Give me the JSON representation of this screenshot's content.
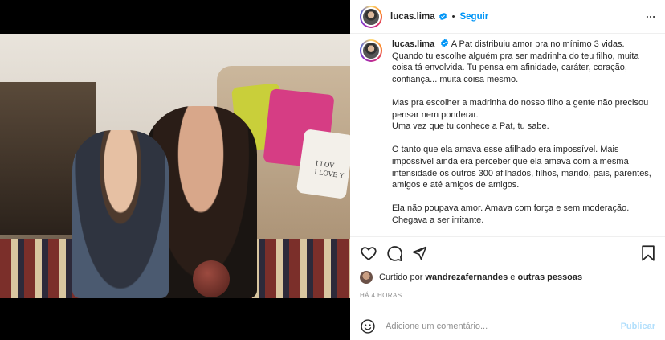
{
  "post": {
    "username": "lucas.lima",
    "follow_label": "Seguir",
    "separator": "•",
    "more_icon": "more-horizontal-icon",
    "verified_icon": "verified-badge-icon"
  },
  "caption": {
    "username": "lucas.lima",
    "paragraphs": [
      "A Pat distribuiu amor pra no mínimo 3 vidas. Quando tu escolhe alguém pra ser madrinha do teu filho, muita coisa tá envolvida. Tu pensa em afinidade, caráter, coração, confiança... muita coisa mesmo.",
      "Mas pra escolher a madrinha do nosso filho a gente não precisou pensar nem ponderar.\nUma vez que tu conhece a Pat, tu sabe.",
      "O tanto que ela amava esse afilhado era impossível. Mais impossível ainda era perceber que ela amava com a mesma intensidade os outros 300 afilhados, filhos, marido, pais, parentes, amigos e até amigos de amigos.",
      "Ela não poupava amor. Amava com força e sem moderação. Chegava a ser irritante."
    ]
  },
  "photo": {
    "pillow_text": "I LOV\nI LOVE Y"
  },
  "actions": {
    "like_icon": "heart-icon",
    "comment_icon": "comment-icon",
    "share_icon": "send-icon",
    "save_icon": "bookmark-icon"
  },
  "likes": {
    "prefix": "Curtido por",
    "user": "wandrezafernandes",
    "connector": "e",
    "others": "outras pessoas"
  },
  "timestamp": "HÁ 4 HORAS",
  "comment": {
    "placeholder": "Adicione um comentário...",
    "publish_label": "Publicar",
    "emoji_icon": "emoji-icon"
  },
  "colors": {
    "accent": "#0095f6",
    "publish_disabled": "#b2dffc",
    "muted": "#8e8e8e",
    "text": "#262626"
  }
}
